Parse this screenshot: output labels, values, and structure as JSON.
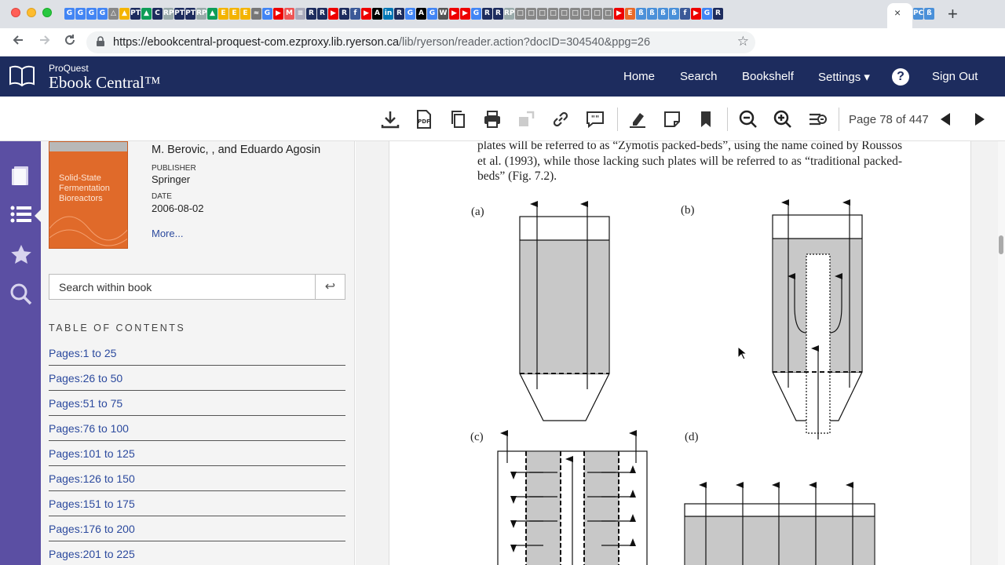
{
  "browser": {
    "url_host": "https://ebookcentral-proquest-com.ezproxy.lib.ryerson.ca",
    "url_path": "/lib/ryerson/reader.action?docID=304540&ppg=26",
    "tab_close": "×",
    "new_tab": "+",
    "favicons": [
      {
        "t": "G",
        "c": "#4285f4"
      },
      {
        "t": "G",
        "c": "#4285f4"
      },
      {
        "t": "G",
        "c": "#4285f4"
      },
      {
        "t": "G",
        "c": "#4285f4"
      },
      {
        "t": "△",
        "c": "#888"
      },
      {
        "t": "▲",
        "c": "#f4b400"
      },
      {
        "t": "PT",
        "c": "#1d2c5e"
      },
      {
        "t": "▲",
        "c": "#0f9d58"
      },
      {
        "t": "C",
        "c": "#1d2c5e"
      },
      {
        "t": "RP",
        "c": "#9aa"
      },
      {
        "t": "PT",
        "c": "#1d2c5e"
      },
      {
        "t": "PT",
        "c": "#1d2c5e"
      },
      {
        "t": "RP",
        "c": "#9aa"
      },
      {
        "t": "▲",
        "c": "#0f9d58"
      },
      {
        "t": "E",
        "c": "#f4b400"
      },
      {
        "t": "E",
        "c": "#f4b400"
      },
      {
        "t": "E",
        "c": "#f4b400"
      },
      {
        "t": "≈",
        "c": "#777"
      },
      {
        "t": "G",
        "c": "#4285f4"
      },
      {
        "t": "▶",
        "c": "#e00"
      },
      {
        "t": "M",
        "c": "#e55"
      },
      {
        "t": "≡",
        "c": "#aab"
      },
      {
        "t": "R",
        "c": "#1d2c5e"
      },
      {
        "t": "R",
        "c": "#1d2c5e"
      },
      {
        "t": "▶",
        "c": "#e00"
      },
      {
        "t": "R",
        "c": "#1d2c5e"
      },
      {
        "t": "f",
        "c": "#3b5998"
      },
      {
        "t": "▶",
        "c": "#e00"
      },
      {
        "t": "A",
        "c": "#000"
      },
      {
        "t": "in",
        "c": "#0077b5"
      },
      {
        "t": "R",
        "c": "#1d2c5e"
      },
      {
        "t": "G",
        "c": "#4285f4"
      },
      {
        "t": "A",
        "c": "#000"
      },
      {
        "t": "G",
        "c": "#4285f4"
      },
      {
        "t": "W",
        "c": "#555"
      },
      {
        "t": "▶",
        "c": "#e00"
      },
      {
        "t": "▶",
        "c": "#e00"
      },
      {
        "t": "G",
        "c": "#4285f4"
      },
      {
        "t": "R",
        "c": "#1d2c5e"
      },
      {
        "t": "R",
        "c": "#1d2c5e"
      },
      {
        "t": "RP",
        "c": "#9aa"
      },
      {
        "t": "□",
        "c": "#888"
      },
      {
        "t": "□",
        "c": "#888"
      },
      {
        "t": "□",
        "c": "#888"
      },
      {
        "t": "□",
        "c": "#888"
      },
      {
        "t": "□",
        "c": "#888"
      },
      {
        "t": "□",
        "c": "#888"
      },
      {
        "t": "□",
        "c": "#888"
      },
      {
        "t": "□",
        "c": "#888"
      },
      {
        "t": "□",
        "c": "#888"
      },
      {
        "t": "▶",
        "c": "#e00"
      },
      {
        "t": "E",
        "c": "#e86a2a"
      },
      {
        "t": "ß",
        "c": "#4a90d9"
      },
      {
        "t": "ß",
        "c": "#4a90d9"
      },
      {
        "t": "ß",
        "c": "#4a90d9"
      },
      {
        "t": "ß",
        "c": "#4a90d9"
      },
      {
        "t": "f",
        "c": "#3b5998"
      },
      {
        "t": "▶",
        "c": "#e00"
      },
      {
        "t": "G",
        "c": "#4285f4"
      },
      {
        "t": "R",
        "c": "#1d2c5e"
      }
    ],
    "active_tab_icon": "RP",
    "after_tabs": [
      {
        "t": "PC",
        "c": "#4a90d9"
      },
      {
        "t": "ß",
        "c": "#4a90d9"
      }
    ]
  },
  "header": {
    "brand_top": "ProQuest",
    "brand_main": "Ebook Central™",
    "nav": [
      "Home",
      "Search",
      "Bookshelf",
      "Settings ▾"
    ],
    "help": "?",
    "signout": "Sign Out"
  },
  "reader": {
    "page_indicator": "Page 78 of 447"
  },
  "sidebar": {
    "cover_title": "Solid-State Fermentation Bioreactors",
    "authors": "M. Berovic, , and Eduardo Agosin",
    "publisher_label": "PUBLISHER",
    "publisher": "Springer",
    "date_label": "DATE",
    "date": "2006-08-02",
    "more": "More...",
    "search_placeholder": "Search within book",
    "search_btn": "↩",
    "toc_heading": "TABLE OF CONTENTS",
    "toc": [
      "Pages:1 to 25",
      "Pages:26 to 50",
      "Pages:51 to 75",
      "Pages:76 to 100",
      "Pages:101 to 125",
      "Pages:126 to 150",
      "Pages:151 to 175",
      "Pages:176 to 200",
      "Pages:201 to 225"
    ]
  },
  "document": {
    "text": "plates will be referred to as “Zymotis packed-beds”, using the name coined by Roussos et al. (1993), while those lacking such plates will be referred to as “traditional packed-beds” (Fig. 7.2).",
    "labels": [
      "(a)",
      "(b)",
      "(c)",
      "(d)"
    ]
  },
  "colors": {
    "header_bg": "#1d2c5e",
    "rail_bg": "#5b4fa3",
    "link": "#2c4a9e",
    "bed_fill": "#c8c8c8"
  }
}
